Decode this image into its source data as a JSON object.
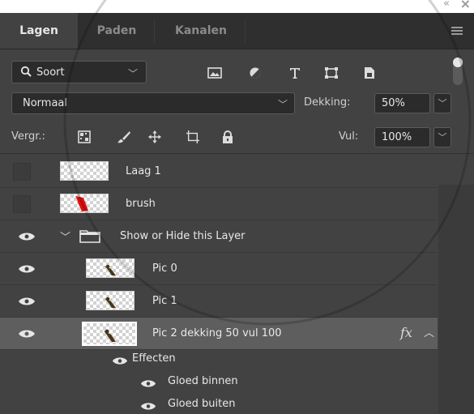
{
  "tabs": [
    {
      "label": "Lagen",
      "active": true
    },
    {
      "label": "Paden",
      "active": false
    },
    {
      "label": "Kanalen",
      "active": false
    }
  ],
  "filter": {
    "kind_label": "Soort",
    "icons": [
      "image-filter-icon",
      "adjustment-filter-icon",
      "type-filter-icon",
      "shape-filter-icon",
      "smart-object-filter-icon"
    ]
  },
  "blend": {
    "mode": "Normaal",
    "opacity_label": "Dekking:",
    "opacity_value": "50%"
  },
  "lock": {
    "label": "Vergr.:",
    "icons": [
      "lock-transparent-pixels-icon",
      "lock-image-pixels-icon",
      "lock-position-icon",
      "lock-artboard-icon",
      "lock-all-icon"
    ],
    "fill_label": "Vul:",
    "fill_value": "100%"
  },
  "layers": [
    {
      "name": "Laag 1",
      "visible": false
    },
    {
      "name": "brush",
      "visible": false
    },
    {
      "name": "Show or Hide this Layer",
      "visible": true,
      "type": "group"
    },
    {
      "name": "Pic 0",
      "visible": true
    },
    {
      "name": "Pic 1",
      "visible": true
    },
    {
      "name": "Pic 2  dekking 50 vul 100",
      "visible": true,
      "selected": true,
      "fx": "fx"
    }
  ],
  "effects": {
    "label": "Effecten",
    "items": [
      {
        "name": "Gloed binnen"
      },
      {
        "name": "Gloed buiten"
      }
    ]
  },
  "colors": {
    "panel": "#424242",
    "tabbar": "#2f2f2f",
    "selected_row": "#5e5e5e",
    "watermark": "#000000"
  }
}
